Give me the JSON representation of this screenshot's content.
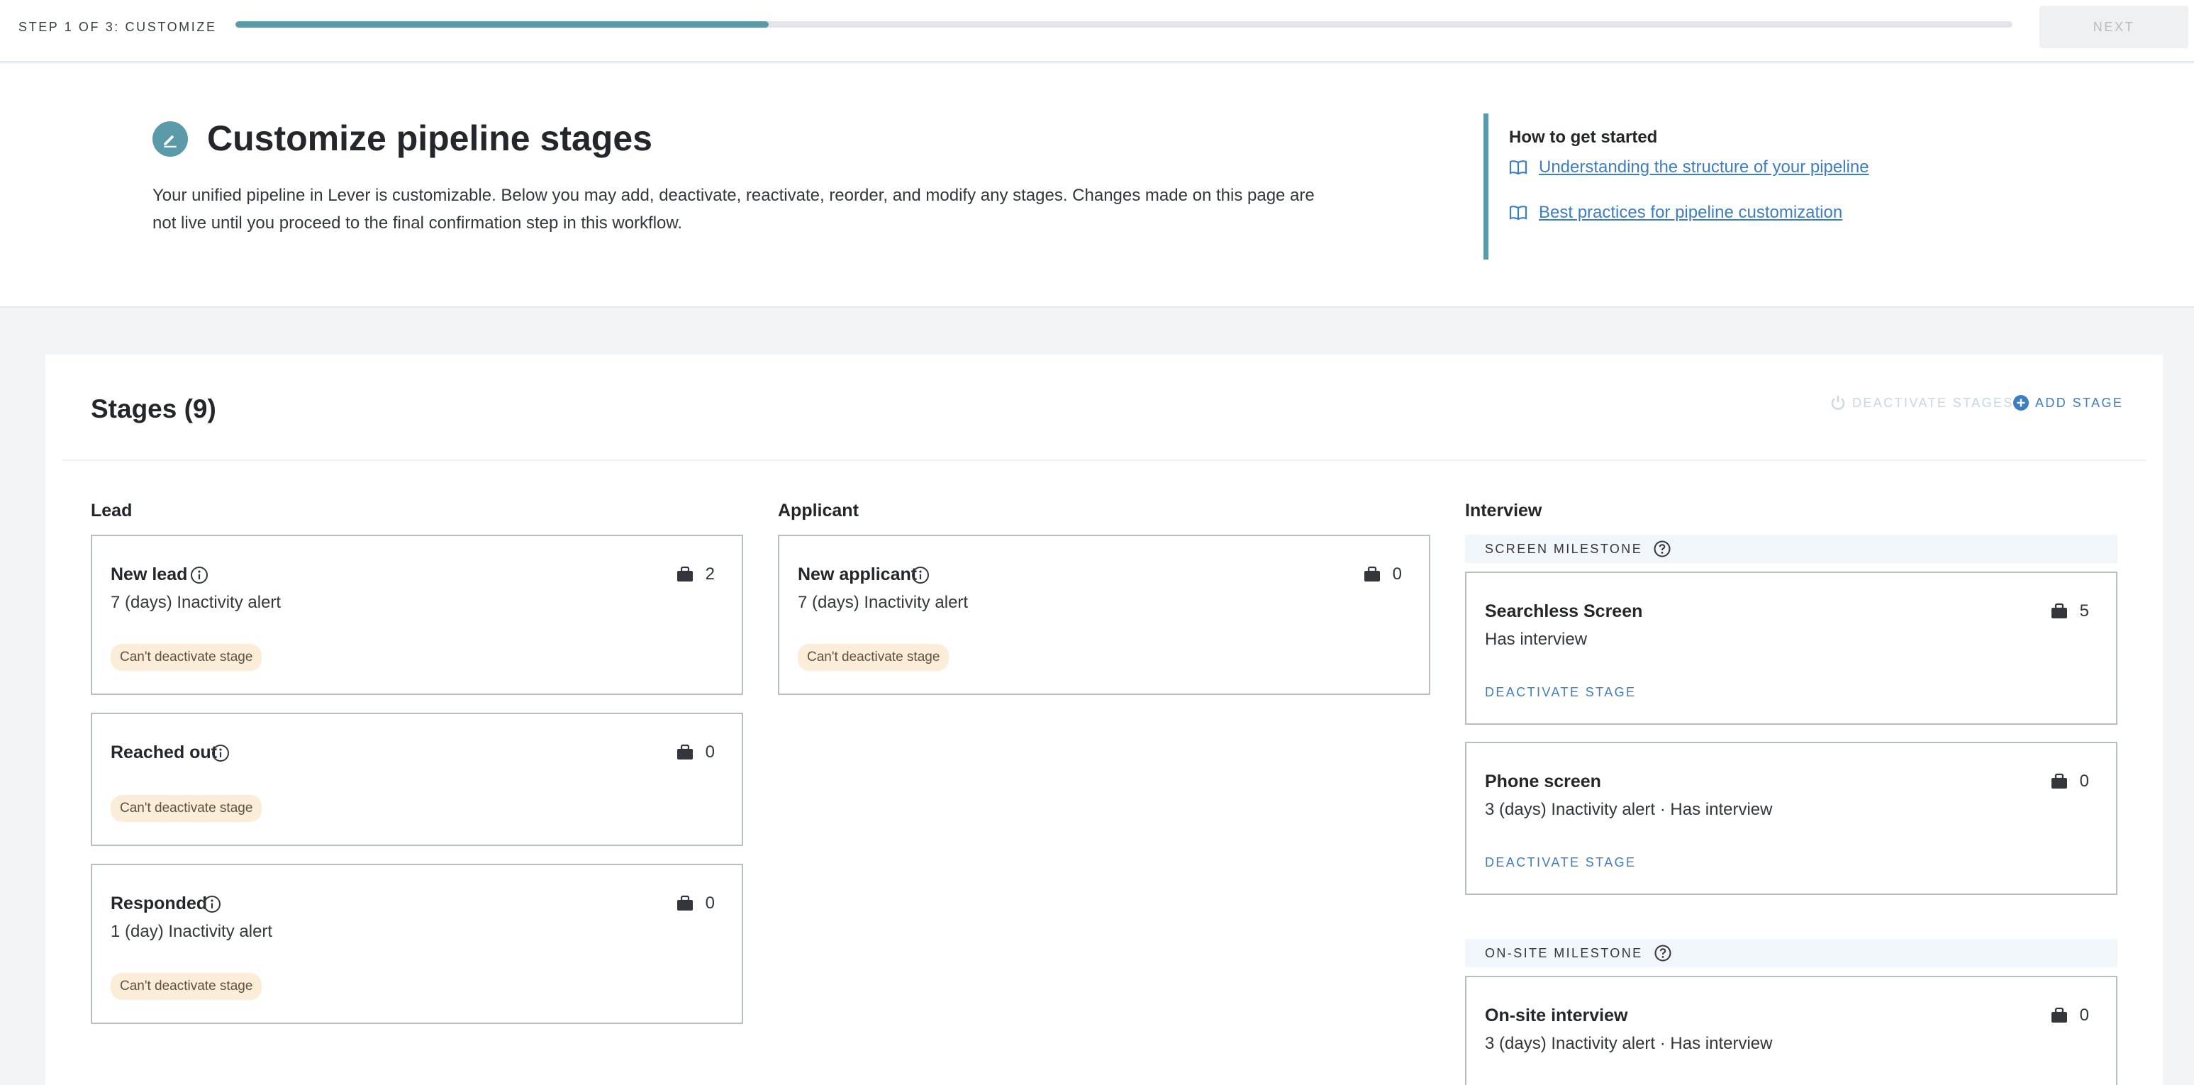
{
  "topbar": {
    "step_label": "STEP 1 OF 3: CUSTOMIZE",
    "progress_percent": 30,
    "next_label": "NEXT"
  },
  "header": {
    "title": "Customize pipeline stages",
    "description": "Your unified pipeline in Lever is customizable. Below you may add, deactivate, reactivate, reorder, and modify any stages. Changes made on this page are not live until you proceed to the final confirmation step in this workflow.",
    "help": {
      "title": "How to get started",
      "links": [
        "Understanding the structure of your pipeline",
        "Best practices for pipeline customization"
      ]
    }
  },
  "stages": {
    "title": "Stages (9)",
    "deactivate_label": "DEACTIVATE STAGES",
    "add_label": "ADD STAGE",
    "columns": [
      {
        "title": "Lead",
        "cards": [
          {
            "name": "New lead",
            "count": "2",
            "meta": "7 (days) Inactivity alert",
            "badge": "Can't deactivate stage"
          },
          {
            "name": "Reached out",
            "count": "0",
            "badge": "Can't deactivate stage"
          },
          {
            "name": "Responded",
            "count": "0",
            "meta": "1 (day) Inactivity alert",
            "badge": "Can't deactivate stage"
          }
        ]
      },
      {
        "title": "Applicant",
        "cards": [
          {
            "name": "New applicant",
            "count": "0",
            "meta": "7 (days) Inactivity alert",
            "badge": "Can't deactivate stage"
          }
        ]
      },
      {
        "title": "Interview",
        "milestones": [
          "SCREEN MILESTONE",
          "ON-SITE MILESTONE"
        ],
        "cards": [
          {
            "name": "Searchless Screen",
            "count": "5",
            "meta": "Has interview",
            "action": "DEACTIVATE STAGE"
          },
          {
            "name": "Phone screen",
            "count": "0",
            "meta": "3 (days) Inactivity alert · Has interview",
            "action": "DEACTIVATE STAGE"
          },
          {
            "name": "On-site interview",
            "count": "0",
            "meta": "3 (days) Inactivity alert · Has interview"
          }
        ]
      }
    ]
  },
  "colors": {
    "accent": "#5b9aa8",
    "link": "#3d7dc4",
    "badge_bg": "#fbedd8"
  },
  "icons": [
    "edit-pencil-icon",
    "book-icon",
    "power-icon",
    "plus-circle-icon",
    "info-icon",
    "briefcase-icon",
    "question-icon"
  ]
}
